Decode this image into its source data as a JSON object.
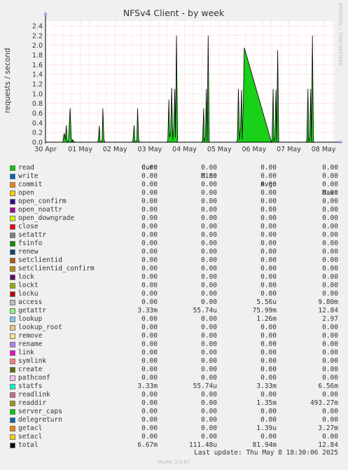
{
  "chart_data": {
    "type": "area",
    "title": "NFSv4 Client - by week",
    "ylabel": "requests / second",
    "side_label": "RRDTOOL / TOBI OETIKER",
    "ylim": [
      0,
      2.5
    ],
    "yticks": [
      "0.0",
      "0.2",
      "0.4",
      "0.6",
      "0.8",
      "1.0",
      "1.2",
      "1.4",
      "1.6",
      "1.8",
      "2.0",
      "2.2",
      "2.4"
    ],
    "xticks": [
      "30 Apr",
      "01 May",
      "02 May",
      "03 May",
      "04 May",
      "05 May",
      "06 May",
      "07 May",
      "08 May"
    ],
    "xrange_days": [
      0,
      8.3
    ],
    "series": [
      {
        "name": "total",
        "color": "#00cc00",
        "x": [
          0.0,
          0.5,
          0.52,
          0.54,
          0.57,
          0.6,
          0.62,
          0.64,
          0.66,
          0.68,
          0.71,
          0.74,
          0.76,
          0.78,
          0.81,
          0.84,
          1.5,
          1.52,
          1.55,
          1.57,
          1.6,
          1.63,
          1.65,
          1.68,
          1.71,
          2.5,
          2.52,
          2.55,
          2.57,
          2.6,
          2.63,
          2.65,
          2.68,
          2.71,
          3.5,
          3.52,
          3.55,
          3.57,
          3.6,
          3.63,
          3.66,
          3.69,
          3.72,
          3.74,
          3.77,
          3.8,
          4.5,
          4.52,
          4.55,
          4.57,
          4.6,
          4.63,
          4.65,
          4.68,
          4.71,
          5.5,
          5.52,
          5.55,
          5.58,
          5.61,
          5.64,
          5.66,
          5.69,
          5.72,
          6.5,
          6.52,
          6.55,
          6.57,
          6.6,
          6.63,
          6.65,
          6.68,
          6.71,
          7.5,
          7.52,
          7.55,
          7.57,
          7.6,
          7.63,
          7.65,
          7.68,
          7.71,
          8.3
        ],
        "y": [
          0,
          0,
          0.12,
          0.18,
          0.05,
          0.35,
          0.02,
          0,
          0.05,
          0.34,
          0.7,
          0.1,
          0,
          0.05,
          0.02,
          0,
          0,
          0.05,
          0.34,
          0.02,
          0,
          0.06,
          0.7,
          0.05,
          0,
          0,
          0.06,
          0.35,
          0.02,
          0,
          0.06,
          0.7,
          0.05,
          0,
          0,
          0.04,
          0.88,
          0.1,
          0.2,
          1.12,
          0.05,
          0.3,
          1.1,
          0.1,
          2.2,
          0,
          0,
          0.05,
          0.7,
          0.02,
          0.1,
          1.1,
          0.02,
          2.2,
          0,
          0,
          0.05,
          1.1,
          0.05,
          0.3,
          1.08,
          0.05,
          0.78,
          1.95,
          0,
          0.05,
          1.1,
          0.02,
          0.1,
          1.08,
          0.02,
          1.9,
          0,
          0,
          0.05,
          1.1,
          0.02,
          0.1,
          1.1,
          0.02,
          2.2,
          0,
          0
        ]
      }
    ]
  },
  "legend": {
    "headers": {
      "cur": "Cur:",
      "min": "Min:",
      "avg": "Avg:",
      "max": "Max:"
    },
    "rows": [
      {
        "name": "read",
        "color": "#00cc00",
        "cur": "0.00",
        "min": "0.00",
        "avg": "0.00",
        "max": "0.00"
      },
      {
        "name": "write",
        "color": "#0066b3",
        "cur": "0.00",
        "min": "0.00",
        "avg": "0.00",
        "max": "0.00"
      },
      {
        "name": "commit",
        "color": "#ff8000",
        "cur": "0.00",
        "min": "0.00",
        "avg": "0.00",
        "max": "0.00"
      },
      {
        "name": "open",
        "color": "#ffcc00",
        "cur": "0.00",
        "min": "0.00",
        "avg": "0.00",
        "max": "0.00"
      },
      {
        "name": "open_confirm",
        "color": "#330099",
        "cur": "0.00",
        "min": "0.00",
        "avg": "0.00",
        "max": "0.00"
      },
      {
        "name": "open_noattr",
        "color": "#990099",
        "cur": "0.00",
        "min": "0.00",
        "avg": "0.00",
        "max": "0.00"
      },
      {
        "name": "open_downgrade",
        "color": "#ccff00",
        "cur": "0.00",
        "min": "0.00",
        "avg": "0.00",
        "max": "0.00"
      },
      {
        "name": "close",
        "color": "#ff0000",
        "cur": "0.00",
        "min": "0.00",
        "avg": "0.00",
        "max": "0.00"
      },
      {
        "name": "setattr",
        "color": "#808080",
        "cur": "0.00",
        "min": "0.00",
        "avg": "0.00",
        "max": "0.00"
      },
      {
        "name": "fsinfo",
        "color": "#008f00",
        "cur": "0.00",
        "min": "0.00",
        "avg": "0.00",
        "max": "0.00"
      },
      {
        "name": "renew",
        "color": "#00487d",
        "cur": "0.00",
        "min": "0.00",
        "avg": "0.00",
        "max": "0.00"
      },
      {
        "name": "setclientid",
        "color": "#b35a00",
        "cur": "0.00",
        "min": "0.00",
        "avg": "0.00",
        "max": "0.00"
      },
      {
        "name": "setclientid_confirm",
        "color": "#b38f00",
        "cur": "0.00",
        "min": "0.00",
        "avg": "0.00",
        "max": "0.00"
      },
      {
        "name": "lock",
        "color": "#6b006b",
        "cur": "0.00",
        "min": "0.00",
        "avg": "0.00",
        "max": "0.00"
      },
      {
        "name": "lockt",
        "color": "#8fb300",
        "cur": "0.00",
        "min": "0.00",
        "avg": "0.00",
        "max": "0.00"
      },
      {
        "name": "locku",
        "color": "#b30000",
        "cur": "0.00",
        "min": "0.00",
        "avg": "0.00",
        "max": "0.00"
      },
      {
        "name": "access",
        "color": "#bebebe",
        "cur": "0.00",
        "min": "0.00",
        "avg": "5.56u",
        "max": "9.80m"
      },
      {
        "name": "getattr",
        "color": "#80ff80",
        "cur": "3.33m",
        "min": "55.74u",
        "avg": "75.99m",
        "max": "12.84"
      },
      {
        "name": "lookup",
        "color": "#80c9ff",
        "cur": "0.00",
        "min": "0.00",
        "avg": "1.26m",
        "max": "2.97"
      },
      {
        "name": "lookup_root",
        "color": "#ffc080",
        "cur": "0.00",
        "min": "0.00",
        "avg": "0.00",
        "max": "0.00"
      },
      {
        "name": "remove",
        "color": "#ffe680",
        "cur": "0.00",
        "min": "0.00",
        "avg": "0.00",
        "max": "0.00"
      },
      {
        "name": "rename",
        "color": "#aa80ff",
        "cur": "0.00",
        "min": "0.00",
        "avg": "0.00",
        "max": "0.00"
      },
      {
        "name": "link",
        "color": "#ee00cc",
        "cur": "0.00",
        "min": "0.00",
        "avg": "0.00",
        "max": "0.00"
      },
      {
        "name": "symlink",
        "color": "#ff8080",
        "cur": "0.00",
        "min": "0.00",
        "avg": "0.00",
        "max": "0.00"
      },
      {
        "name": "create",
        "color": "#666600",
        "cur": "0.00",
        "min": "0.00",
        "avg": "0.00",
        "max": "0.00"
      },
      {
        "name": "pathconf",
        "color": "#ffbfff",
        "cur": "0.00",
        "min": "0.00",
        "avg": "0.00",
        "max": "0.00"
      },
      {
        "name": "statfs",
        "color": "#00ffcc",
        "cur": "3.33m",
        "min": "55.74u",
        "avg": "3.33m",
        "max": "6.56m"
      },
      {
        "name": "readlink",
        "color": "#cc6699",
        "cur": "0.00",
        "min": "0.00",
        "avg": "0.00",
        "max": "0.00"
      },
      {
        "name": "readdir",
        "color": "#999900",
        "cur": "0.00",
        "min": "0.00",
        "avg": "1.35m",
        "max": "493.27m"
      },
      {
        "name": "server_caps",
        "color": "#00cc00",
        "cur": "0.00",
        "min": "0.00",
        "avg": "0.00",
        "max": "0.00"
      },
      {
        "name": "delegreturn",
        "color": "#0066b3",
        "cur": "0.00",
        "min": "0.00",
        "avg": "0.00",
        "max": "0.00"
      },
      {
        "name": "getacl",
        "color": "#ff8000",
        "cur": "0.00",
        "min": "0.00",
        "avg": "1.39u",
        "max": "3.27m"
      },
      {
        "name": "setacl",
        "color": "#ffcc00",
        "cur": "0.00",
        "min": "0.00",
        "avg": "0.00",
        "max": "0.00"
      },
      {
        "name": "total",
        "color": "#000000",
        "cur": "6.67m",
        "min": "111.48u",
        "avg": "81.94m",
        "max": "12.84"
      }
    ]
  },
  "footer": {
    "last_update": "Last update: Thu May  8 18:30:06 2025",
    "munin": "Munin 2.0.67"
  }
}
